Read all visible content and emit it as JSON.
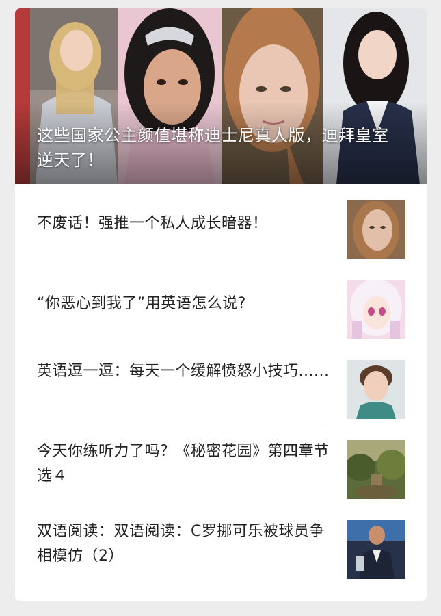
{
  "hero": {
    "title": "这些国家公主颜值堪称迪士尼真人版，迪拜皇室逆天了！",
    "images": [
      "princess-blonde-photo",
      "princess-tiara-photo",
      "girl-redhair-photo",
      "woman-suit-photo"
    ]
  },
  "articles": [
    {
      "title": "不废话！强推一个私人成长暗器！",
      "thumbnail": "woman-portrait-thumbnail"
    },
    {
      "title": "“你恶心到我了”用英语怎么说?",
      "thumbnail": "anime-girl-thumbnail"
    },
    {
      "title": "英语逗一逗：每天一个缓解愤怒小技巧......",
      "thumbnail": "young-man-thumbnail"
    },
    {
      "title": "今天你练听力了吗？《秘密花园》第四章节选４",
      "thumbnail": "garden-thumbnail"
    },
    {
      "title": "双语阅读：双语阅读：C罗挪可乐被球员争相模仿（2）",
      "thumbnail": "footballer-thumbnail"
    }
  ]
}
